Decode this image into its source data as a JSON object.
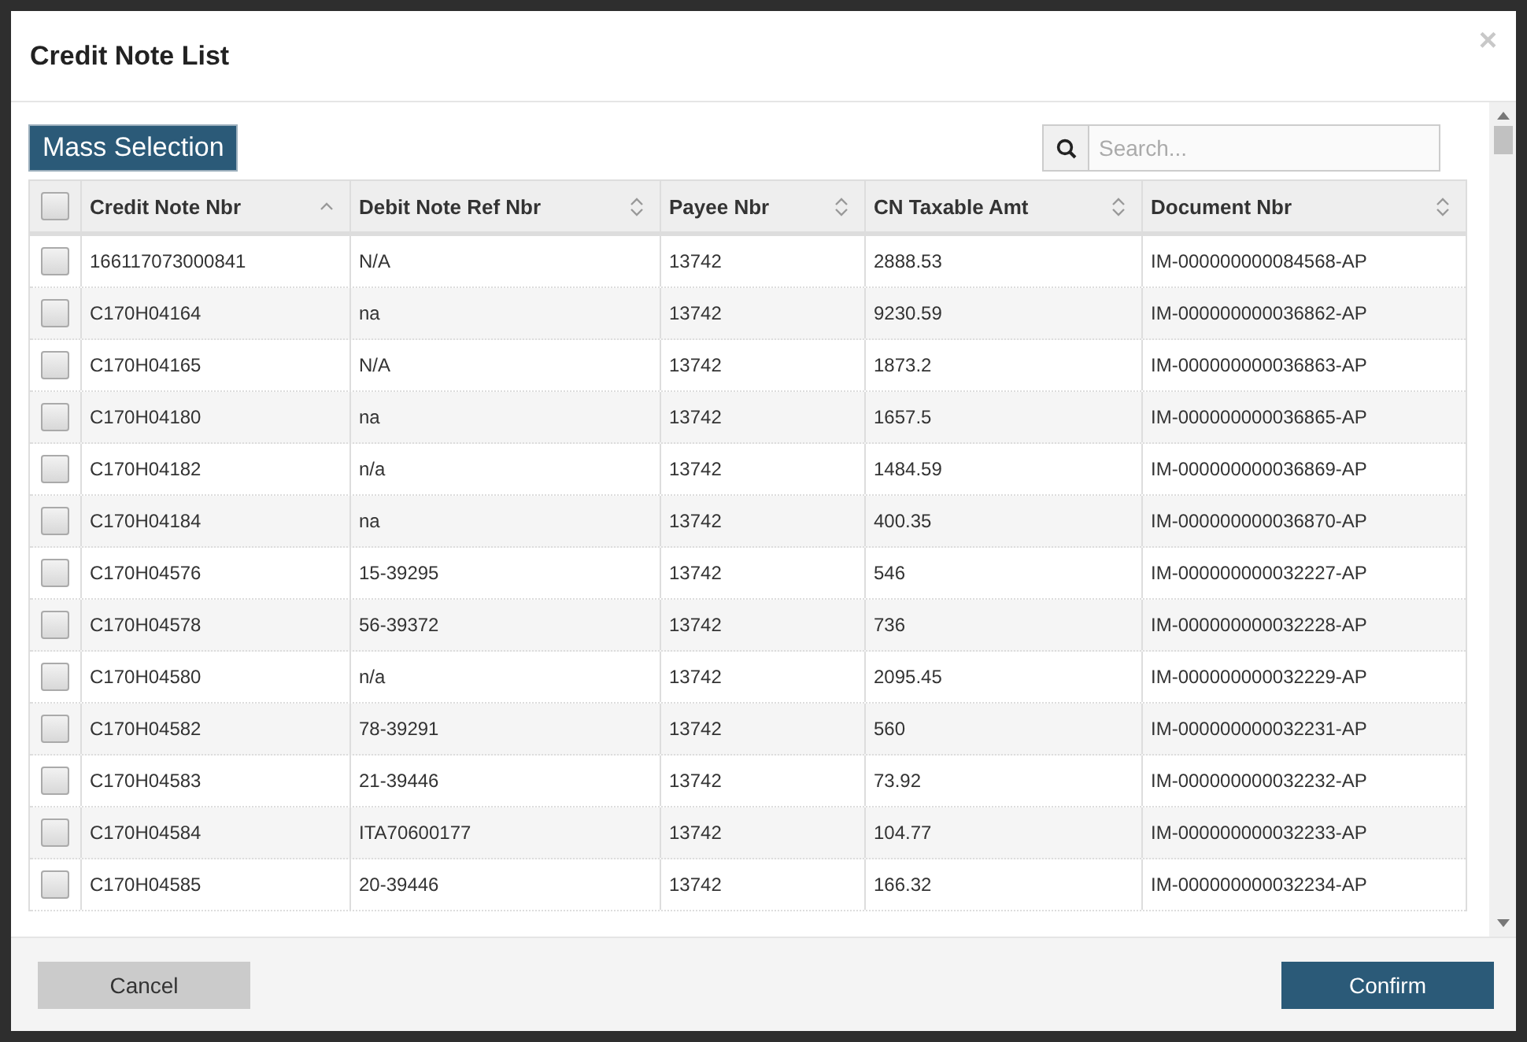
{
  "dialog": {
    "title": "Credit Note List",
    "close": "×"
  },
  "mass_selection": "Mass Selection",
  "search": {
    "placeholder": "Search..."
  },
  "table": {
    "select_all": {
      "checked": false
    },
    "columns": [
      {
        "label": "Credit Note Nbr",
        "sorted": true
      },
      {
        "label": "Debit Note Ref Nbr",
        "sorted": false
      },
      {
        "label": "Payee Nbr",
        "sorted": false
      },
      {
        "label": "CN Taxable Amt",
        "sorted": false
      },
      {
        "label": "Document Nbr",
        "sorted": false
      }
    ],
    "rows": [
      {
        "checked": false,
        "cells": [
          "166117073000841",
          "N/A",
          "13742",
          "2888.53",
          "IM-000000000084568-AP"
        ]
      },
      {
        "checked": false,
        "cells": [
          "C170H04164",
          "na",
          "13742",
          "9230.59",
          "IM-000000000036862-AP"
        ]
      },
      {
        "checked": false,
        "cells": [
          "C170H04165",
          "N/A",
          "13742",
          "1873.2",
          "IM-000000000036863-AP"
        ]
      },
      {
        "checked": false,
        "cells": [
          "C170H04180",
          "na",
          "13742",
          "1657.5",
          "IM-000000000036865-AP"
        ]
      },
      {
        "checked": false,
        "cells": [
          "C170H04182",
          "n/a",
          "13742",
          "1484.59",
          "IM-000000000036869-AP"
        ]
      },
      {
        "checked": false,
        "cells": [
          "C170H04184",
          "na",
          "13742",
          "400.35",
          "IM-000000000036870-AP"
        ]
      },
      {
        "checked": false,
        "cells": [
          "C170H04576",
          "15-39295",
          "13742",
          "546",
          "IM-000000000032227-AP"
        ]
      },
      {
        "checked": false,
        "cells": [
          "C170H04578",
          "56-39372",
          "13742",
          "736",
          "IM-000000000032228-AP"
        ]
      },
      {
        "checked": false,
        "cells": [
          "C170H04580",
          "n/a",
          "13742",
          "2095.45",
          "IM-000000000032229-AP"
        ]
      },
      {
        "checked": false,
        "cells": [
          "C170H04582",
          "78-39291",
          "13742",
          "560",
          "IM-000000000032231-AP"
        ]
      },
      {
        "checked": false,
        "cells": [
          "C170H04583",
          "21-39446",
          "13742",
          "73.92",
          "IM-000000000032232-AP"
        ]
      },
      {
        "checked": false,
        "cells": [
          "C170H04584",
          "ITA70600177",
          "13742",
          "104.77",
          "IM-000000000032233-AP"
        ]
      },
      {
        "checked": false,
        "cells": [
          "C170H04585",
          "20-39446",
          "13742",
          "166.32",
          "IM-000000000032234-AP"
        ]
      }
    ]
  },
  "footer": {
    "cancel": "Cancel",
    "confirm": "Confirm"
  }
}
